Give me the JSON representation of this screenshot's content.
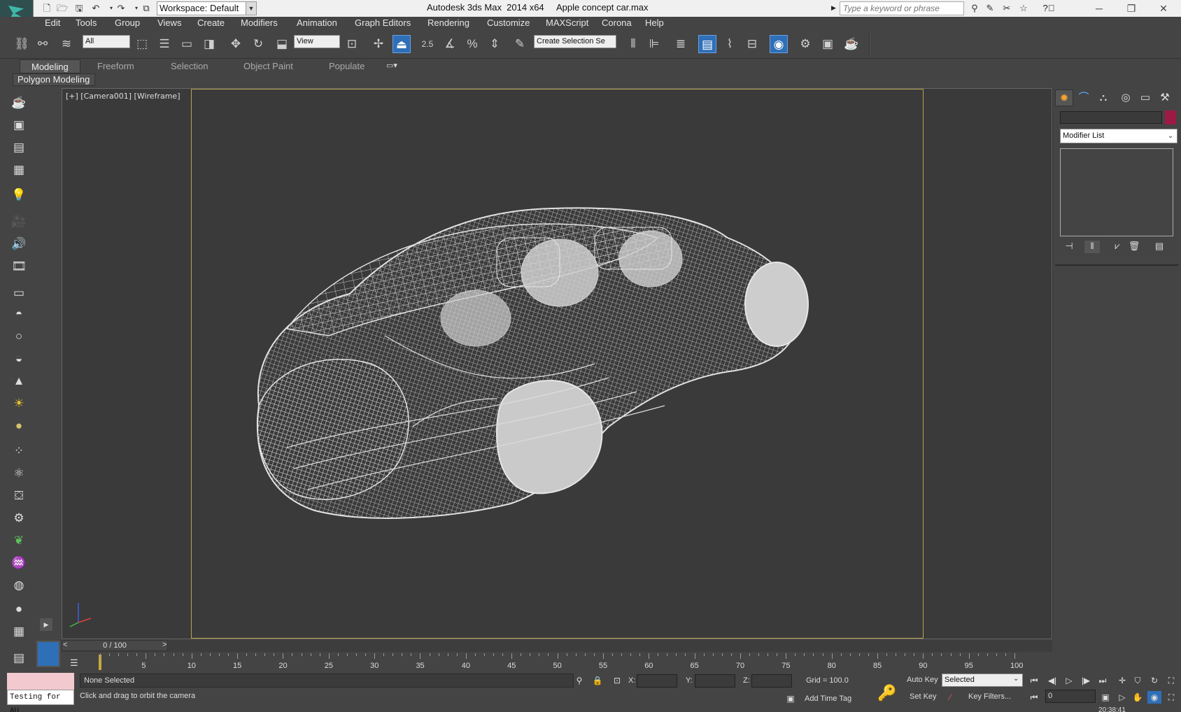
{
  "titlebar": {
    "workspace": "Workspace: Default",
    "app_title": "Autodesk 3ds Max  2014 x64     Apple concept car.max",
    "search_placeholder": "Type a keyword or phrase"
  },
  "menu": [
    "Edit",
    "Tools",
    "Group",
    "Views",
    "Create",
    "Modifiers",
    "Animation",
    "Graph Editors",
    "Rendering",
    "Customize",
    "MAXScript",
    "Corona",
    "Help"
  ],
  "toolbar": {
    "selection_filter": "All",
    "ref_coord": "View",
    "snap_angle_label": "2.5",
    "named_selection": "Create Selection Se"
  },
  "ribbon": {
    "tabs": [
      "Modeling",
      "Freeform",
      "Selection",
      "Object Paint",
      "Populate"
    ],
    "active_tab": "Modeling",
    "panel": "Polygon Modeling"
  },
  "viewport": {
    "label": "[+] [Camera001] [Wireframe]",
    "wire_color": "#d8d8d8",
    "background": "#3a3a3a",
    "safe_frame_color": "#b9a34c"
  },
  "command_panel": {
    "modifier_list": "Modifier List",
    "object_color": "#9d1a45"
  },
  "timeline": {
    "slider_label": "0 / 100",
    "ticks": [
      "5",
      "10",
      "15",
      "20",
      "25",
      "30",
      "35",
      "40",
      "45",
      "50",
      "55",
      "60",
      "65",
      "70",
      "75",
      "80",
      "85",
      "90",
      "95",
      "100"
    ]
  },
  "status": {
    "maxscript_listener": "Testing for AU",
    "selection": "None Selected",
    "prompt": "Click and drag to orbit the camera",
    "x_label": "X:",
    "y_label": "Y:",
    "z_label": "Z:",
    "grid": "Grid = 100.0",
    "add_time_tag": "Add Time Tag",
    "auto_key": "Auto Key",
    "set_key": "Set Key",
    "key_mode": "Selected",
    "key_filters": "Key Filters...",
    "current_frame": "0",
    "clock": "20:38:41"
  }
}
